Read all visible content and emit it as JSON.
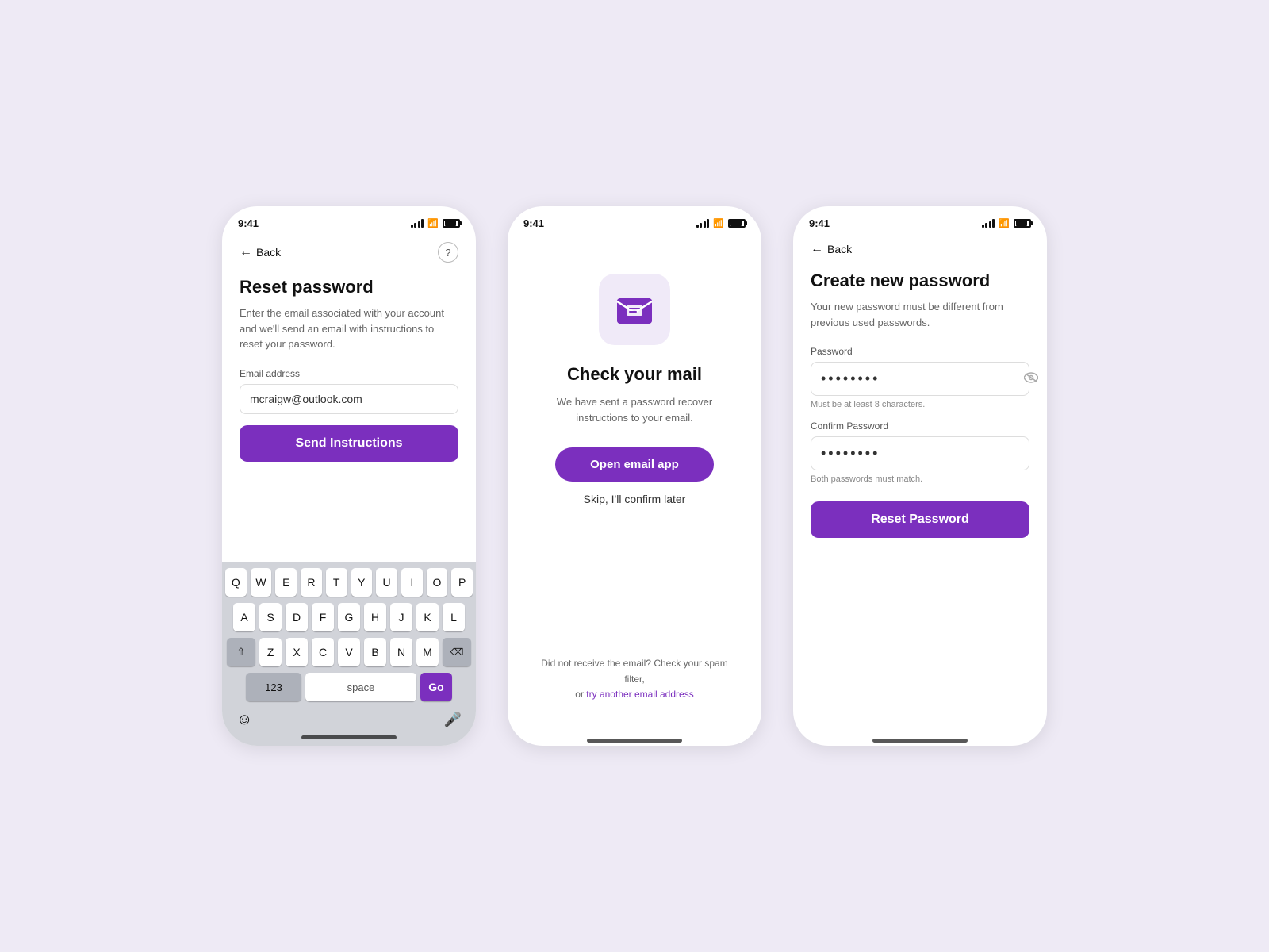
{
  "page": {
    "bg_color": "#eeeaf5",
    "accent_color": "#7B2FBE"
  },
  "screen1": {
    "time": "9:41",
    "back_label": "Back",
    "title": "Reset password",
    "subtitle": "Enter the email associated with your account and we'll send an email with instructions to reset your password.",
    "email_label": "Email address",
    "email_value": "mcraigw@outlook.com",
    "email_placeholder": "Email address",
    "send_button": "Send Instructions",
    "keyboard": {
      "row1": [
        "Q",
        "W",
        "E",
        "R",
        "T",
        "Y",
        "U",
        "I",
        "O",
        "P"
      ],
      "row2": [
        "A",
        "S",
        "D",
        "F",
        "G",
        "H",
        "J",
        "K",
        "L"
      ],
      "row3": [
        "Z",
        "X",
        "C",
        "V",
        "B",
        "N",
        "M"
      ],
      "num_label": "123",
      "space_label": "space",
      "go_label": "Go"
    }
  },
  "screen2": {
    "time": "9:41",
    "mail_icon": "📧",
    "title": "Check your mail",
    "subtitle": "We have sent a password recover instructions to your email.",
    "open_email_btn": "Open email app",
    "skip_link": "Skip, I'll confirm later",
    "bottom_note_prefix": "Did not receive the email? Check your spam filter,",
    "bottom_note_or": "or",
    "bottom_note_link": "try another email address"
  },
  "screen3": {
    "time": "9:41",
    "back_label": "Back",
    "title": "Create new password",
    "subtitle": "Your new password must be different from previous used passwords.",
    "password_label": "Password",
    "password_value": "••••••••",
    "password_hint": "Must be at least 8 characters.",
    "confirm_label": "Confirm Password",
    "confirm_value": "••••••••",
    "confirm_hint": "Both passwords must match.",
    "reset_btn": "Reset Password"
  }
}
